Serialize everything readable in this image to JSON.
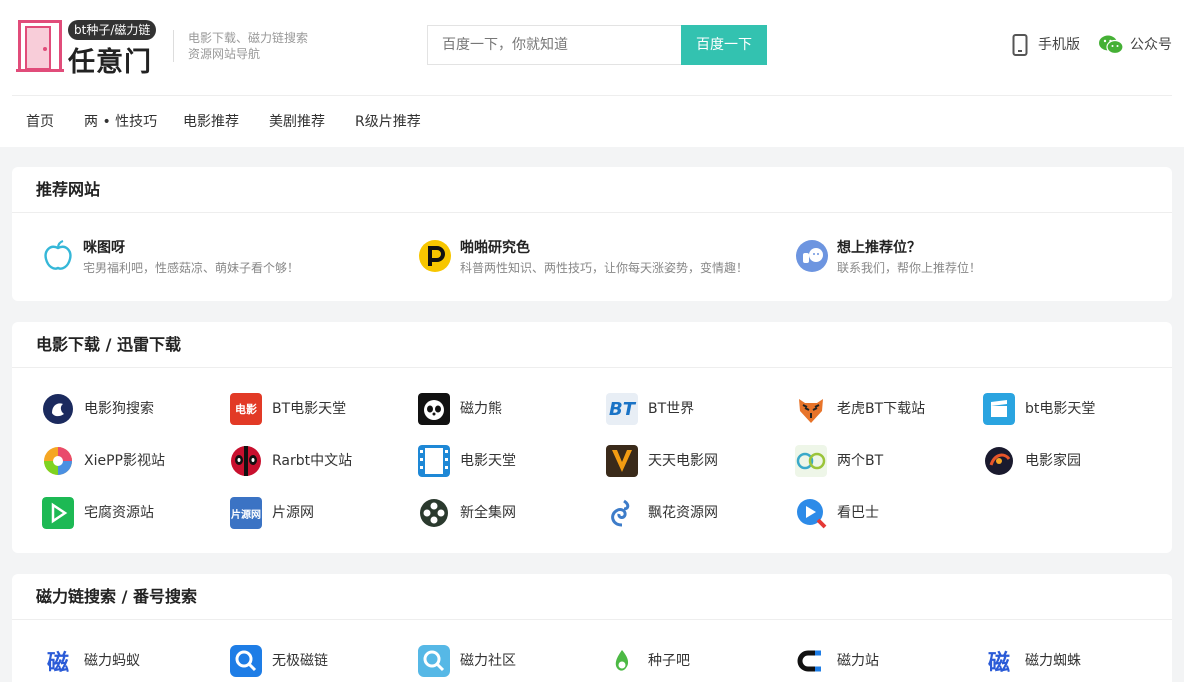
{
  "header": {
    "logo_tag": "bt种子/磁力链",
    "logo_text": "任意门",
    "slogan_line1": "电影下载、磁力链搜索",
    "slogan_line2": "资源网站导航",
    "search_placeholder": "百度一下，你就知道",
    "search_button": "百度一下",
    "mobile_label": "手机版",
    "wechat_label": "公众号"
  },
  "nav": [
    "首页",
    "两 • 性技巧",
    "电影推荐",
    "美剧推荐",
    "R级片推荐"
  ],
  "recommended": {
    "title": "推荐网站",
    "items": [
      {
        "name": "咪图呀",
        "desc": "宅男福利吧，性感菇凉、萌妹子看个够！",
        "icon": "apple-outline-icon"
      },
      {
        "name": "啪啪研究色",
        "desc": "科普两性知识、两性技巧，让你每天涨姿势，变情趣！",
        "icon": "p-logo-icon"
      },
      {
        "name": "想上推荐位？",
        "desc": "联系我们，帮你上推荐位！",
        "icon": "thumbs-up-face-icon"
      }
    ]
  },
  "movies": {
    "title": "电影下载 / 迅雷下载",
    "items": [
      {
        "name": "电影狗搜索",
        "icon": "dog-logo-icon"
      },
      {
        "name": "BT电影天堂",
        "icon": "film-red-icon"
      },
      {
        "name": "磁力熊",
        "icon": "panda-icon"
      },
      {
        "name": "BT世界",
        "icon": "bt-text-icon"
      },
      {
        "name": "老虎BT下载站",
        "icon": "tiger-icon"
      },
      {
        "name": "bt电影天堂",
        "icon": "clapper-icon"
      },
      {
        "name": "XiePP影视站",
        "icon": "color-wheel-icon"
      },
      {
        "name": "Rarbt中文站",
        "icon": "deadpool-icon"
      },
      {
        "name": "电影天堂",
        "icon": "film-strip-icon"
      },
      {
        "name": "天天电影网",
        "icon": "v-film-icon"
      },
      {
        "name": "两个BT",
        "icon": "two-reels-icon"
      },
      {
        "name": "电影家园",
        "icon": "film-reel-icon"
      },
      {
        "name": "宅腐资源站",
        "icon": "play-green-icon"
      },
      {
        "name": "片源网",
        "icon": "piyuan-icon"
      },
      {
        "name": "新全集网",
        "icon": "reel-icon"
      },
      {
        "name": "飘花资源网",
        "icon": "swirl-icon"
      },
      {
        "name": "看巴士",
        "icon": "play-search-icon"
      }
    ]
  },
  "magnet": {
    "title": "磁力链搜索 / 番号搜索",
    "items": [
      {
        "name": "磁力蚂蚁",
        "icon": "ci-blue-icon"
      },
      {
        "name": "无极磁链",
        "icon": "search-blue-icon"
      },
      {
        "name": "磁力社区",
        "icon": "search-light-icon"
      },
      {
        "name": "种子吧",
        "icon": "seed-icon"
      },
      {
        "name": "磁力站",
        "icon": "magnet-icon"
      },
      {
        "name": "磁力蜘蛛",
        "icon": "ci-blue2-icon"
      }
    ]
  },
  "colors": {
    "accent": "#33c2b0",
    "logo": "#e14c7a"
  }
}
